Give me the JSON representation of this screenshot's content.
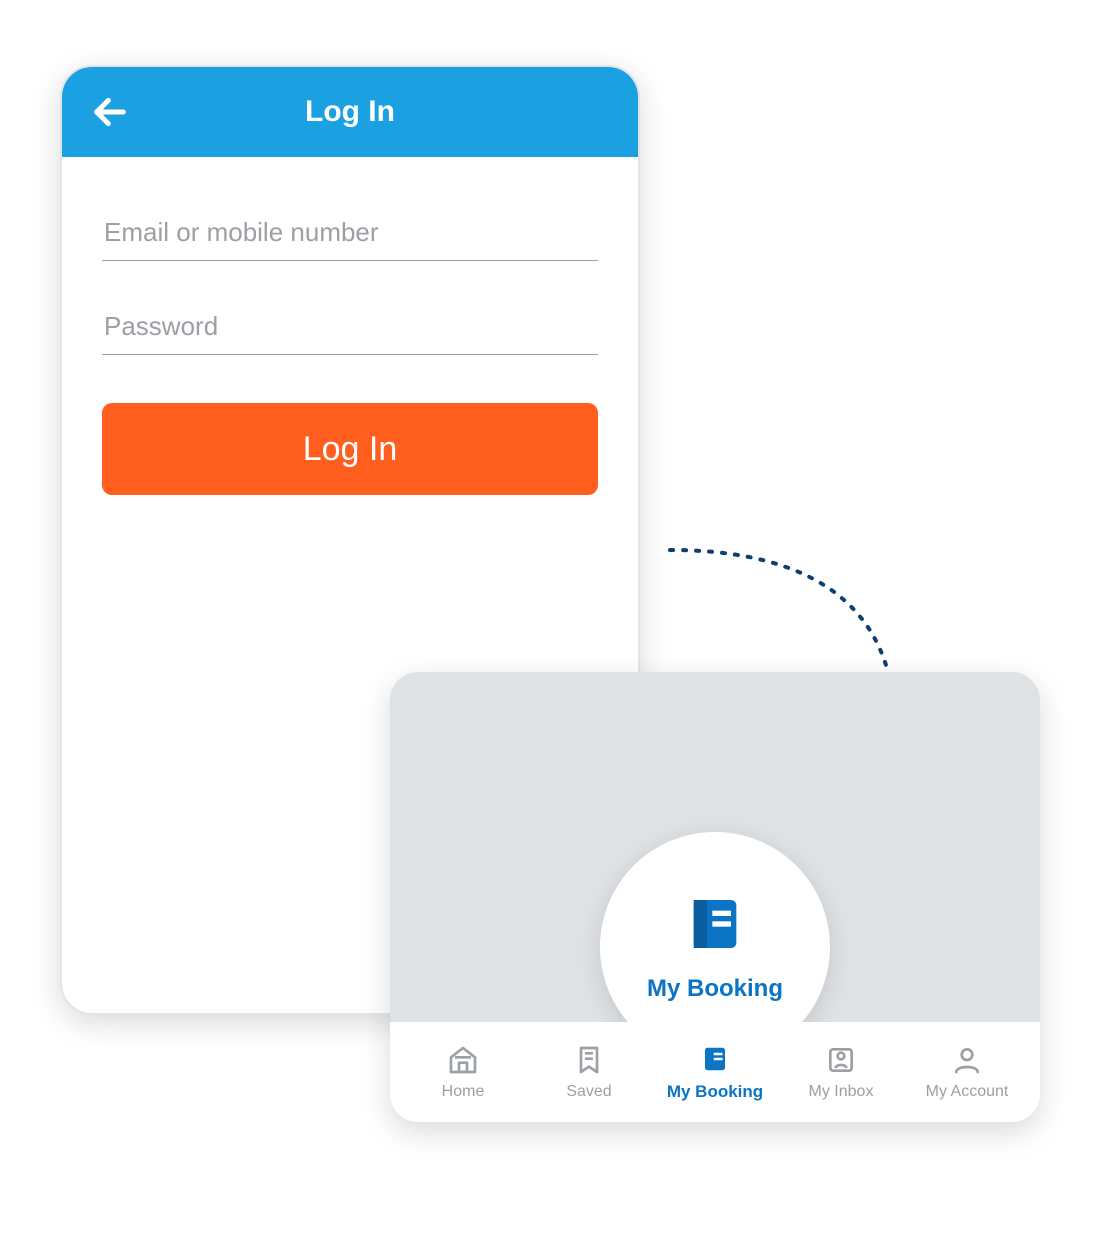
{
  "login": {
    "title": "Log In",
    "email_placeholder": "Email or mobile number",
    "password_placeholder": "Password",
    "button_label": "Log In"
  },
  "bubble": {
    "label": "My Booking"
  },
  "nav": {
    "items": [
      {
        "label": "Home",
        "icon": "home-icon",
        "active": false
      },
      {
        "label": "Saved",
        "icon": "bookmark-icon",
        "active": false
      },
      {
        "label": "My Booking",
        "icon": "booking-icon",
        "active": true
      },
      {
        "label": "My Inbox",
        "icon": "inbox-icon",
        "active": false
      },
      {
        "label": "My Account",
        "icon": "user-icon",
        "active": false
      }
    ]
  },
  "colors": {
    "header": "#1ba0e2",
    "primary_button": "#ff5e1f",
    "active_nav": "#0b74c4",
    "inactive_nav": "#9ca0a4",
    "arrow": "#0e3f6e"
  }
}
